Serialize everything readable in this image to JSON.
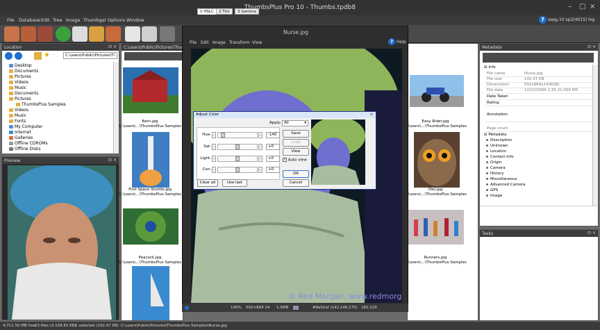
{
  "window": {
    "title": "ThumbsPlus Pro 10 - Thumbs.tpdb8"
  },
  "menubar": {
    "items": [
      "File",
      "Database",
      "Edit",
      "Tree",
      "Image",
      "Thumbgal",
      "Options",
      "Window"
    ],
    "help": "Help",
    "version": "10 sp2(4015) log"
  },
  "location_panel": {
    "title": "Location",
    "path": "C:\\users\\Public\\Pictures\\Tl",
    "tree": [
      "Desktop",
      "Documents",
      "Pictures",
      "Videos",
      "Music",
      "Documents",
      "Pictures",
      "ThumbsPlus Samples",
      "Videos",
      "Music",
      "Fonts",
      "My Computer",
      "Internet",
      "Galleries",
      "Offline CDROMs",
      "Offline Disks"
    ]
  },
  "preview_panel": {
    "title": "Preview"
  },
  "browser": {
    "path": "C:\\users\\Public\\Pictures\\ThumbsPlus",
    "thumbs": [
      {
        "name": "Barn.jpg",
        "dir": "C:\\users\\...\\ThumbsPlus Samples"
      },
      {
        "name": "First Space Shuttle.jpg",
        "dir": "C:\\users\\...\\ThumbsPlus Samples"
      },
      {
        "name": "Peacock.jpg",
        "dir": "C:\\users\\...\\ThumbsPlus Samples"
      },
      {
        "name": "Easy Rider.jpg",
        "dir": "C:\\users\\...\\ThumbsPlus Samples"
      },
      {
        "name": "Owl.jpg",
        "dir": "C:\\users\\...\\ThumbsPlus Samples"
      },
      {
        "name": "Runners.jpg",
        "dir": "C:\\users\\...\\ThumbsPlus Samples"
      }
    ]
  },
  "viewer": {
    "title": "Nurse.jpg",
    "menu": [
      "File",
      "Edit",
      "Image",
      "Transform",
      "View"
    ],
    "help": "Help",
    "watermark": "© Red Morgan, www.redmorgan.com",
    "status": {
      "zoom": "100%",
      "dims": "592×864 24",
      "size": "1.5MB",
      "color": "#8e92af (142,146,175)",
      "coords": "182,129"
    }
  },
  "adjust_dialog": {
    "title": "Adjust Color",
    "tabs": [
      "1 HSLC",
      "2 Tint",
      "3 Gamma"
    ],
    "apply_label": "Apply:",
    "apply_value": "All",
    "sliders": [
      {
        "label": "Hue:",
        "value": "-140",
        "level": 0.08
      },
      {
        "label": "Sat:",
        "value": "+0",
        "level": 0.5
      },
      {
        "label": "Light:",
        "value": "+0",
        "level": 0.5
      },
      {
        "label": "Con:",
        "value": "+0",
        "level": 0.5
      }
    ],
    "buttons": {
      "save": "Save",
      "load": "Load",
      "view": "View",
      "ok": "OK",
      "cancel": "Cancel",
      "clear_all": "Clear all",
      "use_last": "Use last"
    },
    "auto_view": "Auto view"
  },
  "metadata_panel": {
    "title": "Metadata",
    "section": "Info",
    "rows": [
      {
        "k": "File name",
        "v": "Nurse.jpg"
      },
      {
        "k": "File size",
        "v": "102.47 KB"
      },
      {
        "k": "Dimensions",
        "v": "592x864x24(RGB)"
      },
      {
        "k": "File date",
        "v": "12/22/2004  1:35:21.000 PM"
      },
      {
        "k": "Date Taken",
        "v": ""
      },
      {
        "k": "Rating",
        "v": ""
      },
      {
        "k": "Annotation",
        "v": ""
      },
      {
        "k": "Page count",
        "v": ""
      }
    ],
    "metadata_label": "Metadata",
    "categories": [
      "Description",
      "Unknown",
      "Location",
      "Contact Info",
      "Origin",
      "Camera",
      "History",
      "Miscellaneous",
      "Advanced Camera",
      "GPS",
      "Image"
    ]
  },
  "tasks_panel": {
    "title": "Tasks"
  },
  "status": {
    "free": "4,711.50 MB free",
    "files": "23 files (3,158.82 KB)",
    "selected": "1 selected (102.47 KB)",
    "path": "C:\\users\\Public\\Pictures\\ThumbsPlus Samples\\Nurse.jpg"
  }
}
